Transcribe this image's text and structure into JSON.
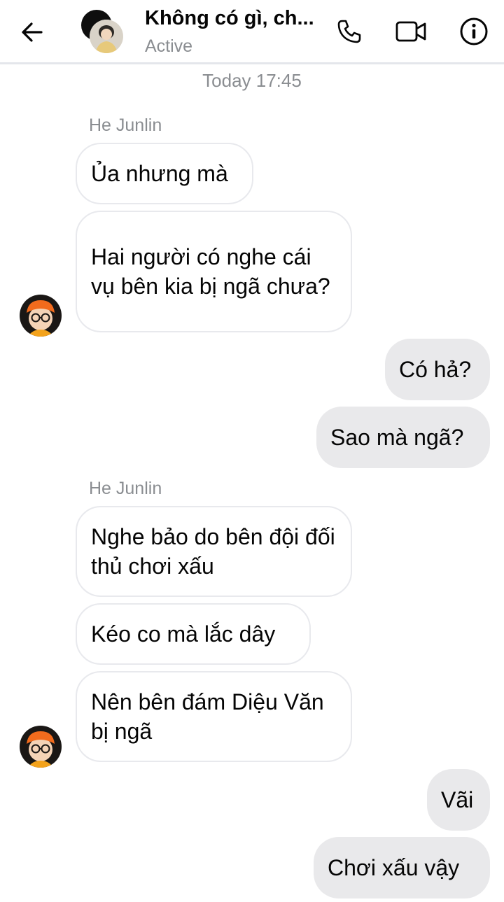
{
  "header": {
    "title": "Không có gì, ch...",
    "status": "Active",
    "icons": [
      "back-arrow-icon",
      "phone-icon",
      "video-icon",
      "info-icon"
    ]
  },
  "timestamp": "Today 17:45",
  "messages": [
    {
      "type": "sender",
      "text": "He Junlin"
    },
    {
      "type": "in",
      "text": "Ủa nhưng mà"
    },
    {
      "type": "in",
      "text": "Hai người có nghe cái vụ bên kia bị ngã chưa?"
    },
    {
      "type": "out",
      "text": "Có hả?"
    },
    {
      "type": "out",
      "text": "Sao mà ngã?"
    },
    {
      "type": "sender",
      "text": "He Junlin"
    },
    {
      "type": "in",
      "text": "Nghe bảo do bên đội đối thủ chơi xấu"
    },
    {
      "type": "in",
      "text": "Kéo co mà lắc dây"
    },
    {
      "type": "in",
      "text": "Nên bên đám Diệu Văn bị ngã"
    },
    {
      "type": "out",
      "text": "Vãi"
    },
    {
      "type": "out",
      "text": "Chơi xấu vậy"
    }
  ],
  "colors": {
    "incoming_bubble_border": "#e8e9ed",
    "outgoing_bubble": "#e9e9eb",
    "muted_text": "#8a8d91",
    "avatar_orange": "#f26b1d"
  }
}
